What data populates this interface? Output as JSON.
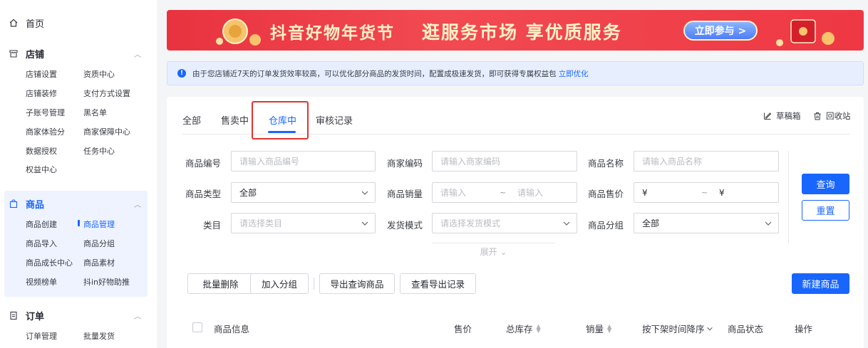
{
  "sidebar": {
    "home": {
      "label": "首页"
    },
    "groups": [
      {
        "title": "店铺",
        "items": [
          "店铺设置",
          "资质中心",
          "店铺装修",
          "支付方式设置",
          "子账号管理",
          "黑名单",
          "商家体验分",
          "商家保障中心",
          "数据授权",
          "任务中心",
          "权益中心"
        ]
      },
      {
        "title": "商品",
        "items": [
          "商品创建",
          "商品管理",
          "商品导入",
          "商品分组",
          "商品成长中心",
          "商品素材",
          "视频榜单",
          "抖in好物助推"
        ],
        "active_item": "商品管理"
      },
      {
        "title": "订单",
        "items": [
          "订单管理",
          "批量发货"
        ]
      }
    ]
  },
  "banner": {
    "title": "抖音好物年货节",
    "subtitle": "逛服务市场 享优质服务",
    "cta": "立即参与 >"
  },
  "notice": {
    "text": "由于您店铺近7天的订单发货效率较高，可以优化部分商品的发货时间，配置成极速发货，即可获得专属权益包",
    "link": "立即优化"
  },
  "tabs": [
    {
      "label": "全部",
      "active": false
    },
    {
      "label": "售卖中",
      "active": false
    },
    {
      "label": "仓库中",
      "active": true
    },
    {
      "label": "审核记录",
      "active": false
    }
  ],
  "utils": {
    "drafts": "草稿箱",
    "recycle": "回收站"
  },
  "filters": {
    "product_id": {
      "label": "商品编号",
      "placeholder": "请输入商品编号"
    },
    "merchant_code": {
      "label": "商家编码",
      "placeholder": "请输入商家编码"
    },
    "product_name": {
      "label": "商品名称",
      "placeholder": "请输入商品名称"
    },
    "product_type": {
      "label": "商品类型",
      "value": "全部"
    },
    "sales": {
      "label": "商品销量",
      "from_placeholder": "请输入",
      "sep": "~",
      "to_placeholder": "请输入"
    },
    "price": {
      "label": "商品售价",
      "from_prefix": "¥",
      "sep": "~",
      "to_prefix": "¥"
    },
    "category": {
      "label": "类目",
      "placeholder": "请选择类目"
    },
    "ship_mode": {
      "label": "发货模式",
      "placeholder": "请选择发货模式"
    },
    "group": {
      "label": "商品分组",
      "value": "全部"
    },
    "expand": "展开 ⌄"
  },
  "actions": {
    "search": "查询",
    "reset": "重置",
    "batch_delete": "批量删除",
    "add_group": "加入分组",
    "export_query": "导出查询商品",
    "export_log": "查看导出记录",
    "new_product": "新建商品"
  },
  "table": {
    "columns": [
      "商品信息",
      "售价",
      "总库存",
      "销量",
      "按下架时间降序",
      "商品状态",
      "操作"
    ]
  }
}
